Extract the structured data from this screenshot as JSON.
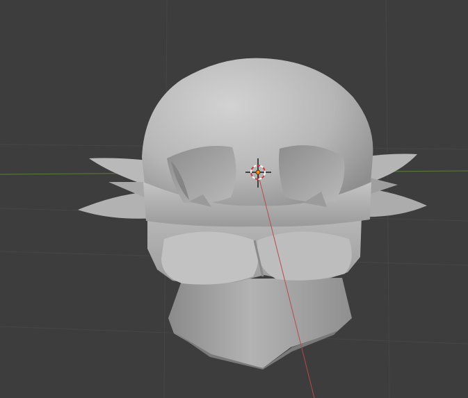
{
  "app": {
    "view": "3d-viewport",
    "mode": "sculpt"
  },
  "colors": {
    "background": "#3d3d3d",
    "grid": "#474747",
    "grid_minor": "#434343",
    "x_axis": "#b84a4a",
    "y_axis": "#6b8e3c",
    "mesh_light": "#c6c6c6",
    "mesh_mid": "#a9a9a9",
    "mesh_dark": "#7e7e7e",
    "origin": "#ff8c00",
    "cursor_red": "#d93636",
    "cursor_white": "#ffffff"
  },
  "icons": {
    "cursor": "3d-cursor-icon",
    "origin": "object-origin-icon"
  }
}
